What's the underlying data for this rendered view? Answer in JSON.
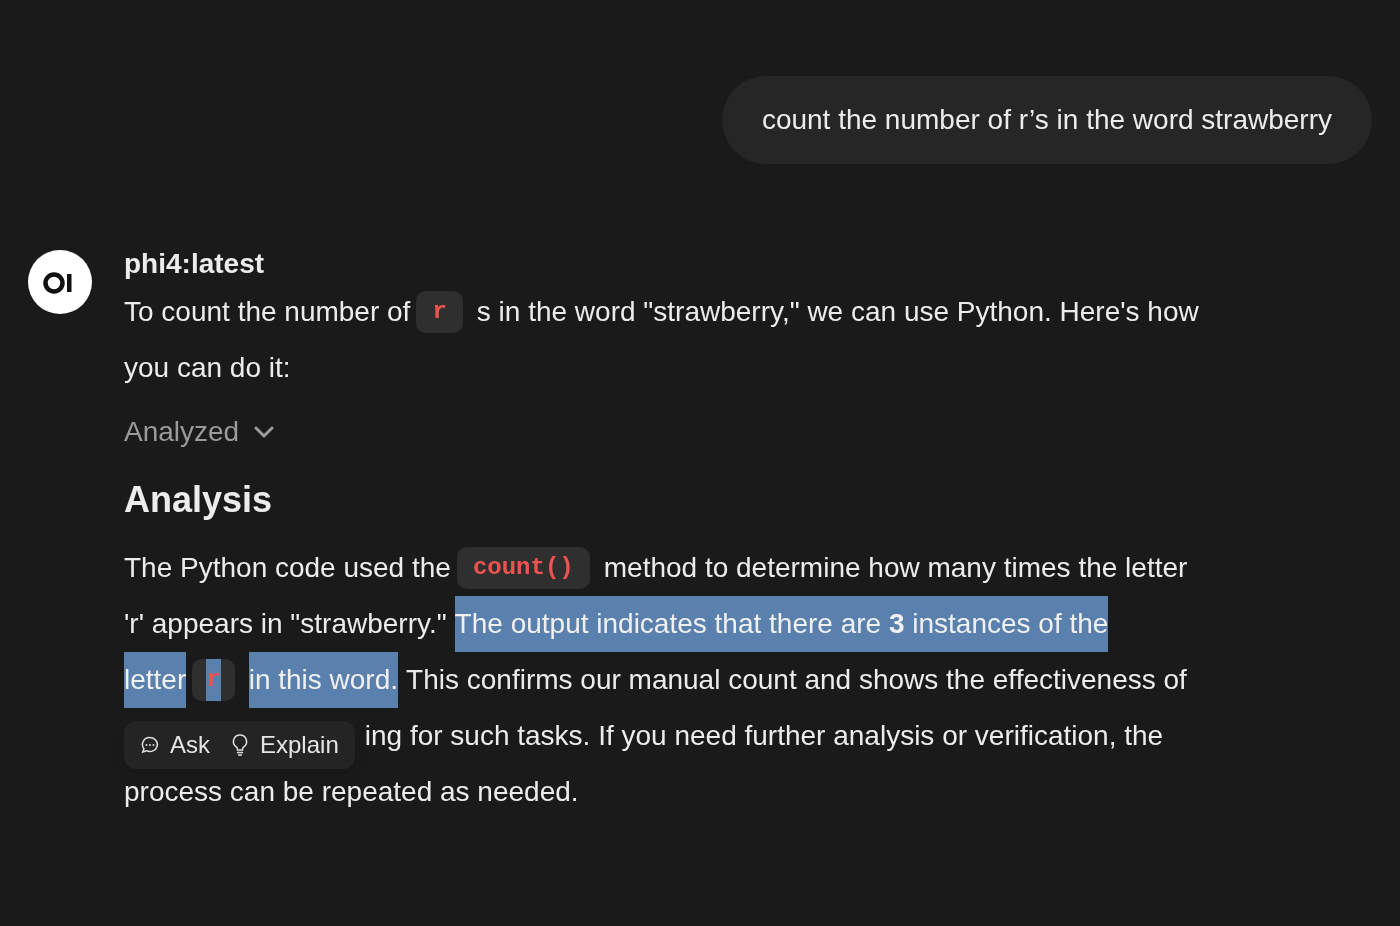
{
  "user_message": {
    "text": "count the number of r’s in the word strawberry"
  },
  "assistant": {
    "model": "phi4:latest",
    "intro": [
      [
        {
          "kind": "text",
          "text": "To count the number of",
          "selected": false
        },
        {
          "kind": "code",
          "text": "r",
          "selected": false
        },
        {
          "kind": "text",
          "text": "s in the word \"strawberry,\" we can use Python. Here's how",
          "selected": false
        }
      ],
      [
        {
          "kind": "text",
          "text": "you can do it:",
          "selected": false
        }
      ]
    ],
    "tool_status": {
      "label": "Analyzed",
      "expanded": false
    },
    "heading": "Analysis",
    "analysis": [
      [
        {
          "kind": "text",
          "text": "The Python code used the",
          "selected": false
        },
        {
          "kind": "code",
          "text": "count()",
          "selected": false
        },
        {
          "kind": "text",
          "text": "method to determine how many times the letter",
          "selected": false
        }
      ],
      [
        {
          "kind": "text",
          "text": "'r' appears in \"strawberry.\"",
          "selected": false
        },
        {
          "kind": "text",
          "text": "The output indicates that there are **3** instances of the",
          "selected": true
        }
      ],
      [
        {
          "kind": "text",
          "text": "letter",
          "selected": true
        },
        {
          "kind": "code",
          "text": "r",
          "selected": true
        },
        {
          "kind": "text",
          "text": "in this word.",
          "selected": true
        },
        {
          "kind": "text",
          "text": "This confirms our manual count and shows the effectiveness of",
          "selected": false
        }
      ],
      [
        {
          "kind": "popup"
        },
        {
          "kind": "text",
          "text": "ing for such tasks. If you need further analysis or verification, the",
          "selected": false
        }
      ],
      [
        {
          "kind": "text",
          "text": "process can be repeated as needed.",
          "selected": false
        }
      ]
    ],
    "selection_popup": {
      "actions": [
        {
          "label": "Ask"
        },
        {
          "label": "Explain"
        }
      ]
    }
  }
}
